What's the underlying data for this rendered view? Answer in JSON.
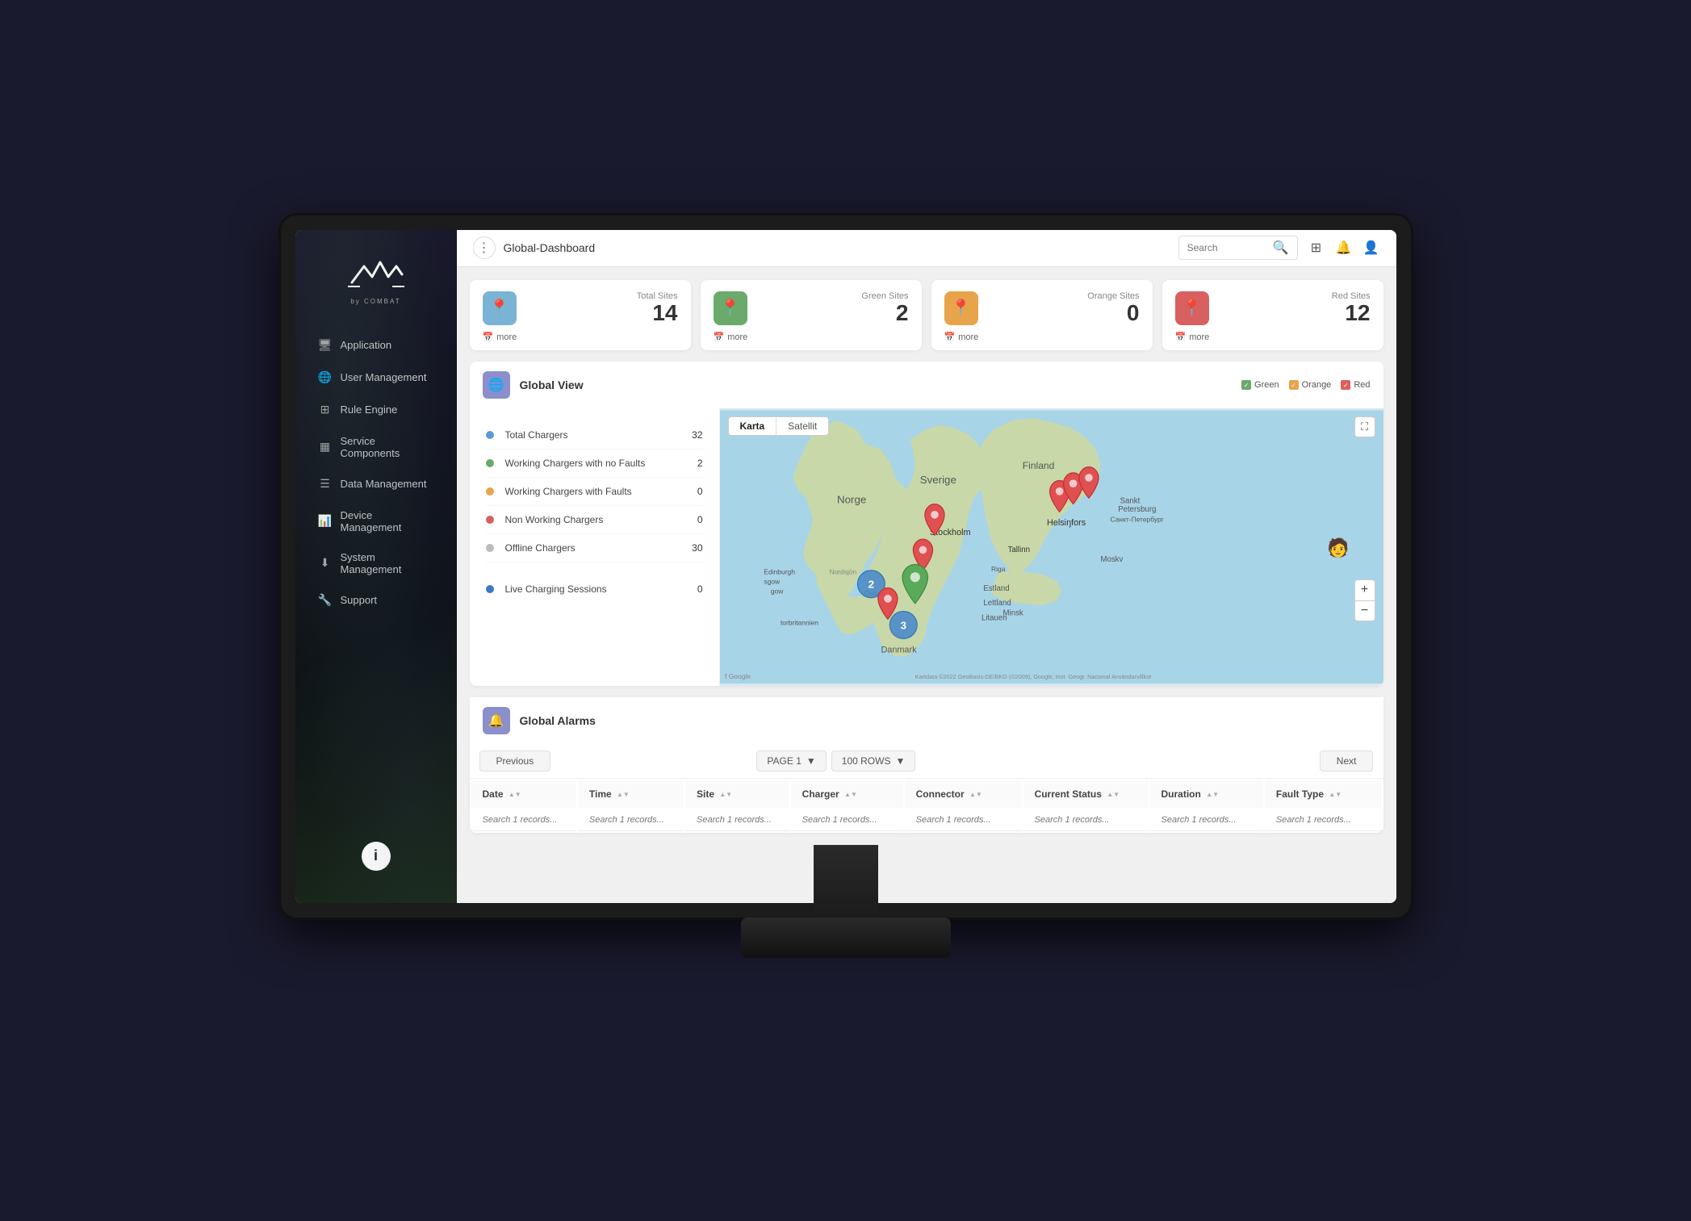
{
  "monitor": {
    "title": "Global-Dashboard"
  },
  "sidebar": {
    "logo_text": "by COMBAT",
    "items": [
      {
        "id": "application",
        "label": "Application",
        "icon": "🖥",
        "active": false
      },
      {
        "id": "user-management",
        "label": "User Management",
        "icon": "👤",
        "active": false
      },
      {
        "id": "rule-engine",
        "label": "Rule Engine",
        "icon": "⊞",
        "active": false
      },
      {
        "id": "service-components",
        "label": "Service Components",
        "icon": "⊟",
        "active": false
      },
      {
        "id": "data-management",
        "label": "Data Management",
        "icon": "☰",
        "active": false
      },
      {
        "id": "device-management",
        "label": "Device Management",
        "icon": "📊",
        "active": false
      },
      {
        "id": "system-management",
        "label": "System Management",
        "icon": "⬇",
        "active": false
      },
      {
        "id": "support",
        "label": "Support",
        "icon": "🔧",
        "active": false
      }
    ],
    "info_label": "i"
  },
  "topbar": {
    "dots_icon": "⋮",
    "title": "Global-Dashboard",
    "search_placeholder": "Search",
    "icons": {
      "grid": "⊞",
      "bell": "🔔",
      "user": "👤"
    }
  },
  "stats": [
    {
      "id": "total-sites",
      "label": "Total Sites",
      "value": "14",
      "color": "blue",
      "footer": "more",
      "footer_icon": "📅"
    },
    {
      "id": "green-sites",
      "label": "Green Sites",
      "value": "2",
      "color": "green",
      "footer": "more",
      "footer_icon": "📅"
    },
    {
      "id": "orange-sites",
      "label": "Orange Sites",
      "value": "0",
      "color": "orange",
      "footer": "more",
      "footer_icon": "📅"
    },
    {
      "id": "red-sites",
      "label": "Red Sites",
      "value": "12",
      "color": "red",
      "footer": "more",
      "footer_icon": "📅"
    }
  ],
  "global_view": {
    "title": "Global View",
    "legend": [
      {
        "color": "green",
        "label": "Green"
      },
      {
        "color": "orange",
        "label": "Orange"
      },
      {
        "color": "red",
        "label": "Red"
      }
    ],
    "charger_stats": [
      {
        "id": "total-chargers",
        "dot": "blue",
        "name": "Total Chargers",
        "value": "32"
      },
      {
        "id": "working-no-faults",
        "dot": "green",
        "name": "Working Chargers with no Faults",
        "value": "2"
      },
      {
        "id": "working-with-faults",
        "dot": "orange",
        "name": "Working Chargers with Faults",
        "value": "0"
      },
      {
        "id": "non-working",
        "dot": "red",
        "name": "Non Working Chargers",
        "value": "0"
      },
      {
        "id": "offline",
        "dot": "gray",
        "name": "Offline Chargers",
        "value": "30"
      }
    ],
    "divider_value": "",
    "live_sessions": [
      {
        "id": "live-charging",
        "dot": "blue-dark",
        "name": "Live Charging Sessions",
        "value": "0"
      }
    ],
    "map_tabs": [
      {
        "label": "Karta",
        "active": true
      },
      {
        "label": "Satellit",
        "active": false
      }
    ]
  },
  "alarms": {
    "title": "Global Alarms",
    "toolbar": {
      "prev_label": "Previous",
      "page_label": "PAGE 1",
      "rows_label": "100 ROWS",
      "next_label": "Next"
    },
    "columns": [
      {
        "id": "date",
        "label": "Date"
      },
      {
        "id": "time",
        "label": "Time"
      },
      {
        "id": "site",
        "label": "Site"
      },
      {
        "id": "charger",
        "label": "Charger"
      },
      {
        "id": "connector",
        "label": "Connector"
      },
      {
        "id": "current-status",
        "label": "Current Status"
      },
      {
        "id": "duration",
        "label": "Duration"
      },
      {
        "id": "fault-type",
        "label": "Fault Type"
      }
    ],
    "search_placeholder": "Search 1 records..."
  }
}
